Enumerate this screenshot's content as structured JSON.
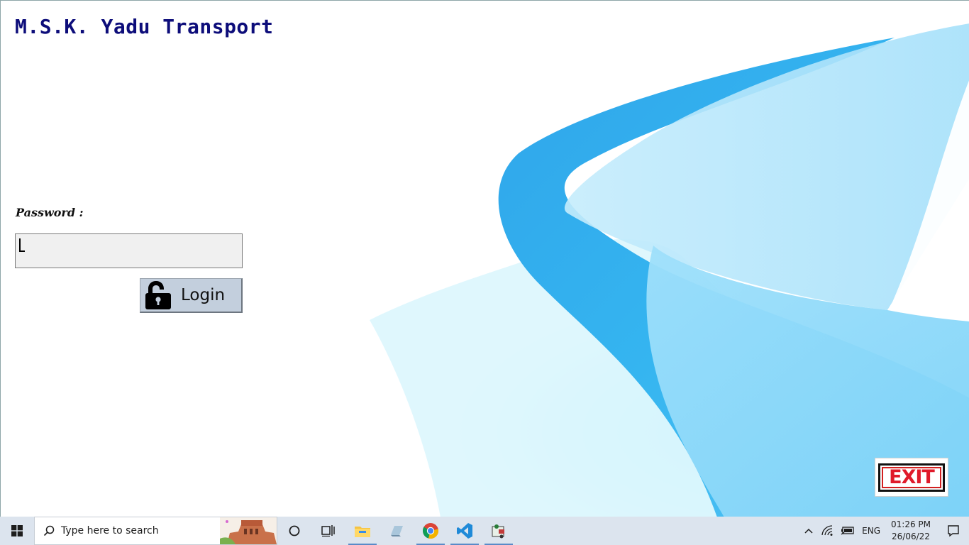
{
  "app": {
    "title": "M.S.K. Yadu Transport"
  },
  "login": {
    "password_label": "Password :",
    "password_value": "",
    "login_button_label": "Login"
  },
  "exit": {
    "label": "EXIT"
  },
  "taskbar": {
    "search_placeholder": "Type here to search",
    "pinned_icons": [
      "cortana-icon",
      "task-view-icon",
      "file-explorer-icon",
      "notepad-icon",
      "chrome-icon",
      "vscode-icon",
      "app-icon"
    ],
    "language": "ENG",
    "time": "01:26 PM",
    "date": "26/06/22"
  },
  "colors": {
    "title": "#0d0d7a",
    "login_button_bg": "#c3cfdd",
    "exit_red": "#e01a2a",
    "taskbar_bg": "#dce4ee",
    "swoosh_dark": "#2aa9ec",
    "swoosh_light": "#a8e4fb"
  }
}
